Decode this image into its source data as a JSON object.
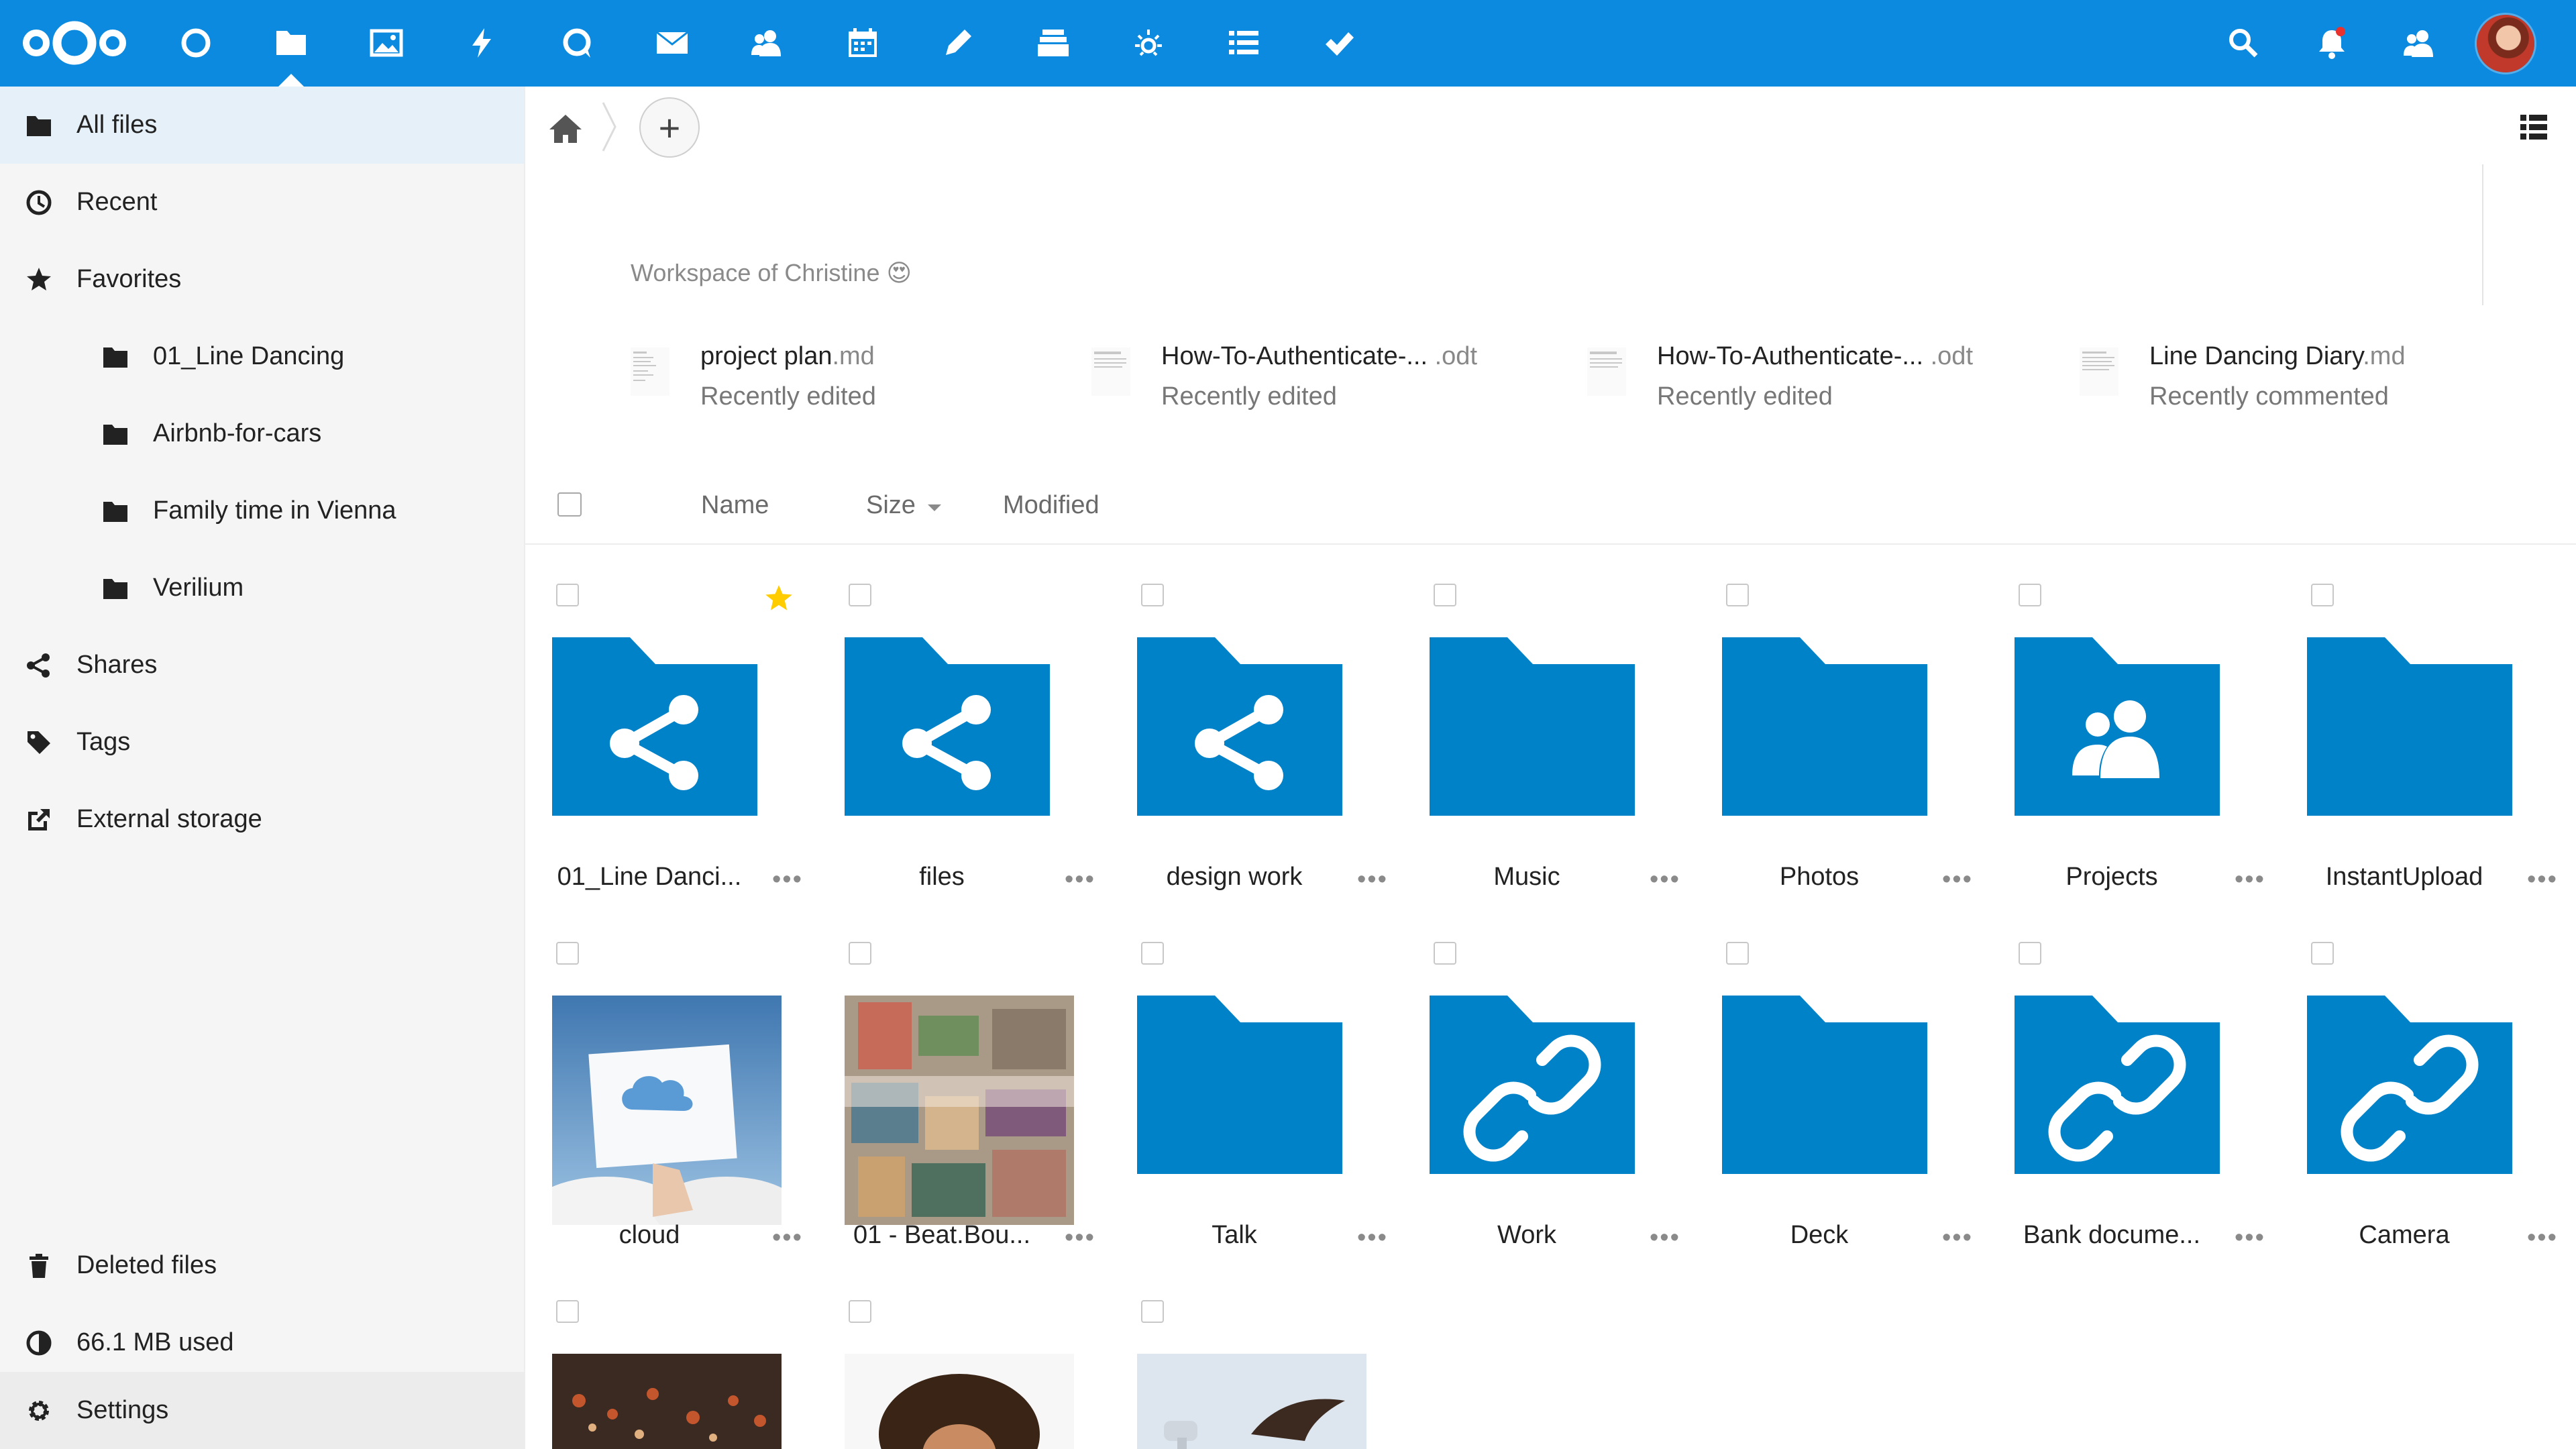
{
  "header": {
    "apps": [
      {
        "name": "dashboard-app",
        "icon": "circle-icon"
      },
      {
        "name": "files-app",
        "icon": "folder-icon",
        "active": true
      },
      {
        "name": "photos-app",
        "icon": "image-icon"
      },
      {
        "name": "activity-app",
        "icon": "lightning-icon"
      },
      {
        "name": "talk-app",
        "icon": "chat-icon"
      },
      {
        "name": "mail-app",
        "icon": "envelope-icon"
      },
      {
        "name": "contacts-app",
        "icon": "contacts-icon"
      },
      {
        "name": "calendar-app",
        "icon": "calendar-icon"
      },
      {
        "name": "notes-app",
        "icon": "pencil-icon"
      },
      {
        "name": "deck-app",
        "icon": "stack-icon"
      },
      {
        "name": "announcements-app",
        "icon": "sun-icon"
      },
      {
        "name": "tasks-app",
        "icon": "list-icon"
      },
      {
        "name": "checkmark-app",
        "icon": "check-icon"
      }
    ],
    "colors": {
      "primary": "#0c8ae0",
      "folder": "#0082c9",
      "star": "#ffcc00"
    }
  },
  "sidebar": {
    "items": [
      {
        "label": "All files",
        "icon": "folder-icon"
      },
      {
        "label": "Recent",
        "icon": "clock-icon"
      },
      {
        "label": "Favorites",
        "icon": "star-icon"
      },
      {
        "label": "01_Line Dancing",
        "icon": "folder-icon"
      },
      {
        "label": "Airbnb-for-cars",
        "icon": "folder-icon"
      },
      {
        "label": "Family time in Vienna",
        "icon": "folder-icon"
      },
      {
        "label": "Verilium",
        "icon": "folder-icon"
      },
      {
        "label": "Shares",
        "icon": "share-icon"
      },
      {
        "label": "Tags",
        "icon": "tag-icon"
      },
      {
        "label": "External storage",
        "icon": "external-icon"
      }
    ],
    "footer": [
      {
        "label": "Deleted files",
        "icon": "trash-icon"
      },
      {
        "label": "66.1 MB used",
        "icon": "quota-icon"
      },
      {
        "label": "Settings",
        "icon": "gear-icon"
      }
    ]
  },
  "controls": {
    "add_label": "+"
  },
  "workspace": {
    "title": "Workspace of Christine 😍"
  },
  "recent": [
    {
      "name": "project plan",
      "ext": ".md",
      "status": "Recently edited"
    },
    {
      "name": "How-To-Authenticate-...",
      "ext": " .odt",
      "status": "Recently edited"
    },
    {
      "name": "How-To-Authenticate-...",
      "ext": " .odt",
      "status": "Recently edited"
    },
    {
      "name": "Line Dancing Diary",
      "ext": ".md",
      "status": "Recently commented"
    }
  ],
  "list_header": {
    "name": "Name",
    "size": "Size",
    "modified": "Modified"
  },
  "files": [
    {
      "name": "01_Line Danci...",
      "type": "shared-folder",
      "favorite": true
    },
    {
      "name": "files",
      "type": "shared-folder"
    },
    {
      "name": "design work",
      "type": "shared-folder"
    },
    {
      "name": "Music",
      "type": "folder"
    },
    {
      "name": "Photos",
      "type": "folder"
    },
    {
      "name": "Projects",
      "type": "group-folder"
    },
    {
      "name": "InstantUpload",
      "type": "folder"
    },
    {
      "name": "cloud",
      "type": "image"
    },
    {
      "name": "01 - Beat.Bou...",
      "type": "image"
    },
    {
      "name": "Talk",
      "type": "folder"
    },
    {
      "name": "Work",
      "type": "link-folder"
    },
    {
      "name": "Deck",
      "type": "folder"
    },
    {
      "name": "Bank docume...",
      "type": "link-folder"
    },
    {
      "name": "Camera",
      "type": "link-folder"
    },
    {
      "name": "",
      "type": "image"
    },
    {
      "name": "",
      "type": "image"
    },
    {
      "name": "",
      "type": "image"
    }
  ],
  "more_label": "•••"
}
